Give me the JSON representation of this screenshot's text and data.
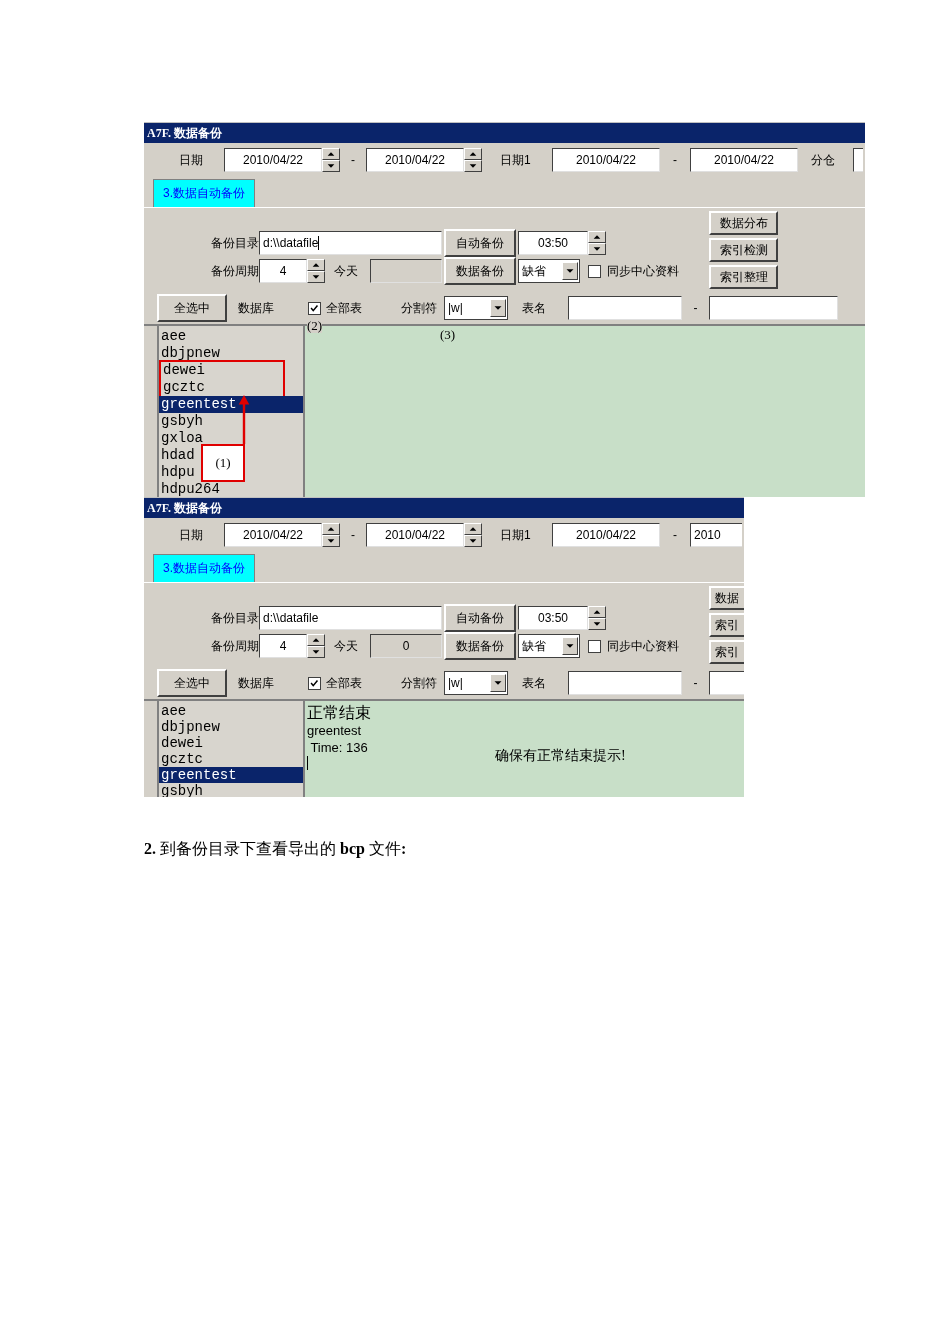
{
  "windows": [
    {
      "title": "A7F. 数据备份",
      "date_label": "日期",
      "date_from": "2010/04/22",
      "date_sep": "-",
      "date_to": "2010/04/22",
      "date1_label": "日期1",
      "date1_from": "2010/04/22",
      "date1_sep": "-",
      "date1_to": "2010/04/22",
      "warehouse_label": "分仓",
      "tabs": [
        {
          "label": "3.数据自动备份",
          "selected": true
        }
      ],
      "dir_label": "备份目录",
      "dir_value": "d:\\\\datafile",
      "dir_focused": true,
      "auto_backup_button": "自动备份",
      "time_value": "03:50",
      "period_label": "备份周期",
      "period_value": "4",
      "today_label": "今天",
      "data_backup_button": "数据备份",
      "mode_value": "缺省",
      "sync": {
        "label": "同步中心资料",
        "checked": false
      },
      "side_buttons": [
        "数据分布",
        "索引检测",
        "索引整理"
      ],
      "select_all_button": "全选中",
      "db_label": "数据库",
      "all_tables": {
        "label": "全部表",
        "checked": true
      },
      "separator_label": "分割符",
      "separator_value": "|w|",
      "table_name_label": "表名",
      "table_name_sep": "-",
      "databases": [
        {
          "name": "aee",
          "selected": false
        },
        {
          "name": "dbjpnew",
          "selected": false
        },
        {
          "name": "dewei",
          "selected": false
        },
        {
          "name": "gcztc",
          "selected": false
        },
        {
          "name": "greentest",
          "selected": true
        },
        {
          "name": "gsbyh",
          "selected": false
        },
        {
          "name": "gxloa",
          "selected": false
        },
        {
          "name": "hdad",
          "selected": false
        },
        {
          "name": "hdpu",
          "selected": false
        },
        {
          "name": "hdpu264",
          "selected": false
        }
      ],
      "annotations": [
        {
          "kind": "highlight"
        },
        {
          "kind": "arrow"
        },
        {
          "kind": "label_box",
          "text": "(1)"
        },
        {
          "kind": "label",
          "text": "(2)"
        },
        {
          "kind": "label",
          "text": "(3)"
        }
      ]
    },
    {
      "title": "A7F. 数据备份",
      "date_label": "日期",
      "date_from": "2010/04/22",
      "date_sep": "-",
      "date_to": "2010/04/22",
      "date1_label": "日期1",
      "date1_from": "2010/04/22",
      "date1_sep": "-",
      "date1_to": "2010",
      "tabs": [
        {
          "label": "3.数据自动备份",
          "selected": true
        }
      ],
      "dir_label": "备份目录",
      "dir_value": "d:\\\\datafile",
      "dir_focused": false,
      "auto_backup_button": "自动备份",
      "time_value": "03:50",
      "period_label": "备份周期",
      "period_value": "4",
      "today_label": "今天",
      "today_value": "0",
      "data_backup_button": "数据备份",
      "mode_value": "缺省",
      "sync": {
        "label": "同步中心资料",
        "checked": false
      },
      "side_buttons": [
        "数据",
        "索引",
        "索引"
      ],
      "select_all_button": "全选中",
      "db_label": "数据库",
      "all_tables": {
        "label": "全部表",
        "checked": true
      },
      "separator_label": "分割符",
      "separator_value": "|w|",
      "table_name_label": "表名",
      "table_name_sep": "-",
      "databases": [
        {
          "name": "aee",
          "selected": false
        },
        {
          "name": "dbjpnew",
          "selected": false
        },
        {
          "name": "dewei",
          "selected": false
        },
        {
          "name": "gcztc",
          "selected": false
        },
        {
          "name": "greentest",
          "selected": true
        },
        {
          "name": "gsbyh",
          "selected": false
        }
      ],
      "output": {
        "lines": [
          {
            "kind": "heading",
            "text": "正常结束"
          },
          {
            "kind": "text",
            "text": "greentest"
          },
          {
            "kind": "text",
            "text": " Time: 136"
          }
        ],
        "caret": true,
        "note": "确保有正常结束提示!"
      }
    }
  ],
  "paragraph": "**2.** 到备份目录下查看导出的 **bcp** 文件**:**"
}
